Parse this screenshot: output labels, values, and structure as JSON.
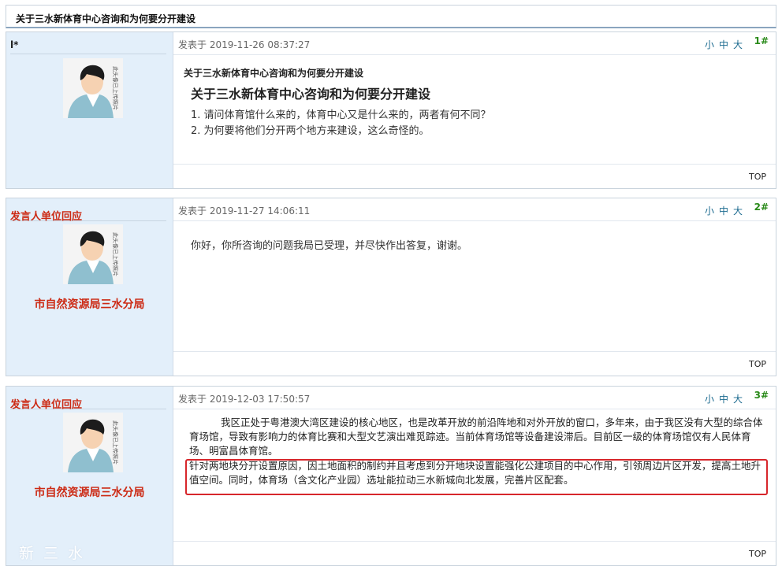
{
  "thread": {
    "title": "关于三水新体育中心咨询和为何要分开建设"
  },
  "font_size_labels": [
    "小",
    "中",
    "大"
  ],
  "top_label": "TOP",
  "watermark": "新三水",
  "avatar_caption": "此头像已上传照片",
  "posts": [
    {
      "user": "l*",
      "date": "发表于 2019-11-26 08:37:27",
      "floor": "1",
      "floor_mark": "#",
      "title_small": "关于三水新体育中心咨询和为何要分开建设",
      "title_big": "关于三水新体育中心咨询和为何要分开建设",
      "lines": [
        "1. 请问体育馆什么来的，体育中心又是什么来的，两者有何不同？",
        "2. 为何要将他们分开两个地方来建设，这么奇怪的。"
      ]
    },
    {
      "user": "发言人单位回应",
      "org": "市自然资源局三水分局",
      "date": "发表于 2019-11-27 14:06:11",
      "floor": "2",
      "floor_mark": "#",
      "text": "你好，你所咨询的问题我局已受理，并尽快作出答复，谢谢。"
    },
    {
      "user": "发言人单位回应",
      "org": "市自然资源局三水分局",
      "date": "发表于 2019-12-03 17:50:57",
      "floor": "3",
      "floor_mark": "#",
      "para1": "我区正处于粤港澳大湾区建设的核心地区，也是改革开放的前沿阵地和对外开放的窗口，多年来，由于我区没有大型的综合体育场馆，导致有影响力的体育比赛和大型文艺演出难觅踪迹。当前体育场馆等设备建设滞后。目前区一级的体育场馆仅有人民体育场、明富昌体育馆。",
      "para2": "针对两地块分开设置原因，因土地面积的制约并且考虑到分开地块设置能强化公建项目的中心作用，引领周边片区开发，提高土地升值空间。同时，体育场（含文化产业园）选址能拉动三水新城向北发展，完善片区配套。"
    }
  ],
  "colors": {
    "sidebar_bg": "#e3effa",
    "org_red": "#cc2a14",
    "floor_green": "#2a8a1a",
    "highlight_border": "#d7262b"
  }
}
